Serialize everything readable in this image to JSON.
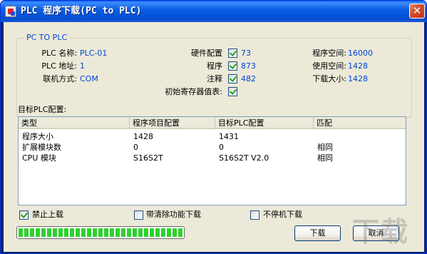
{
  "window": {
    "title": "PLC 程序下载(PC to PLC)",
    "close_glyph": "✕"
  },
  "group": {
    "title": "PC TO PLC",
    "plc_name_label": "PLC 名称:",
    "plc_name_value": "PLC-01",
    "plc_addr_label": "PLC 地址:",
    "plc_addr_value": "1",
    "link_label": "联机方式:",
    "link_value": "COM",
    "hw_config_label": "硬件配置",
    "hw_config_checked": true,
    "hw_config_value": "73",
    "program_label": "程序",
    "program_checked": true,
    "program_value": "873",
    "comment_label": "注释",
    "comment_checked": true,
    "comment_value": "482",
    "init_reg_label": "初始寄存器值表:",
    "init_reg_checked": true,
    "prog_space_label": "程序空间:",
    "prog_space_value": "16000",
    "used_space_label": "使用空间:",
    "used_space_value": "1428",
    "download_size_label": "下载大小:",
    "download_size_value": "1428"
  },
  "target_section_title": "目标PLC配置:",
  "table": {
    "headers": [
      "类型",
      "程序项目配置",
      "目标PLC配置",
      "匹配"
    ],
    "rows": [
      [
        "程序大小",
        "1428",
        "1431",
        ""
      ],
      [
        "扩展模块数",
        "0",
        "0",
        "相同"
      ],
      [
        "CPU 模块",
        "S16S2T",
        "S16S2T V2.0",
        "相同"
      ]
    ]
  },
  "options": {
    "forbid_upload_label": "禁止上载",
    "forbid_upload_checked": true,
    "with_clear_label": "带清除功能下载",
    "with_clear_checked": false,
    "no_stop_label": "不停机下载",
    "no_stop_checked": false
  },
  "progress": {
    "value": 1.0,
    "color": "#2fd12f"
  },
  "buttons": {
    "download": "下载",
    "cancel": "取消"
  },
  "watermark": "下载",
  "colors": {
    "title_bar": "#0453d8",
    "dialog_bg": "#ece9d8",
    "value_text": "#0046d5",
    "close_button": "#d34b27"
  }
}
